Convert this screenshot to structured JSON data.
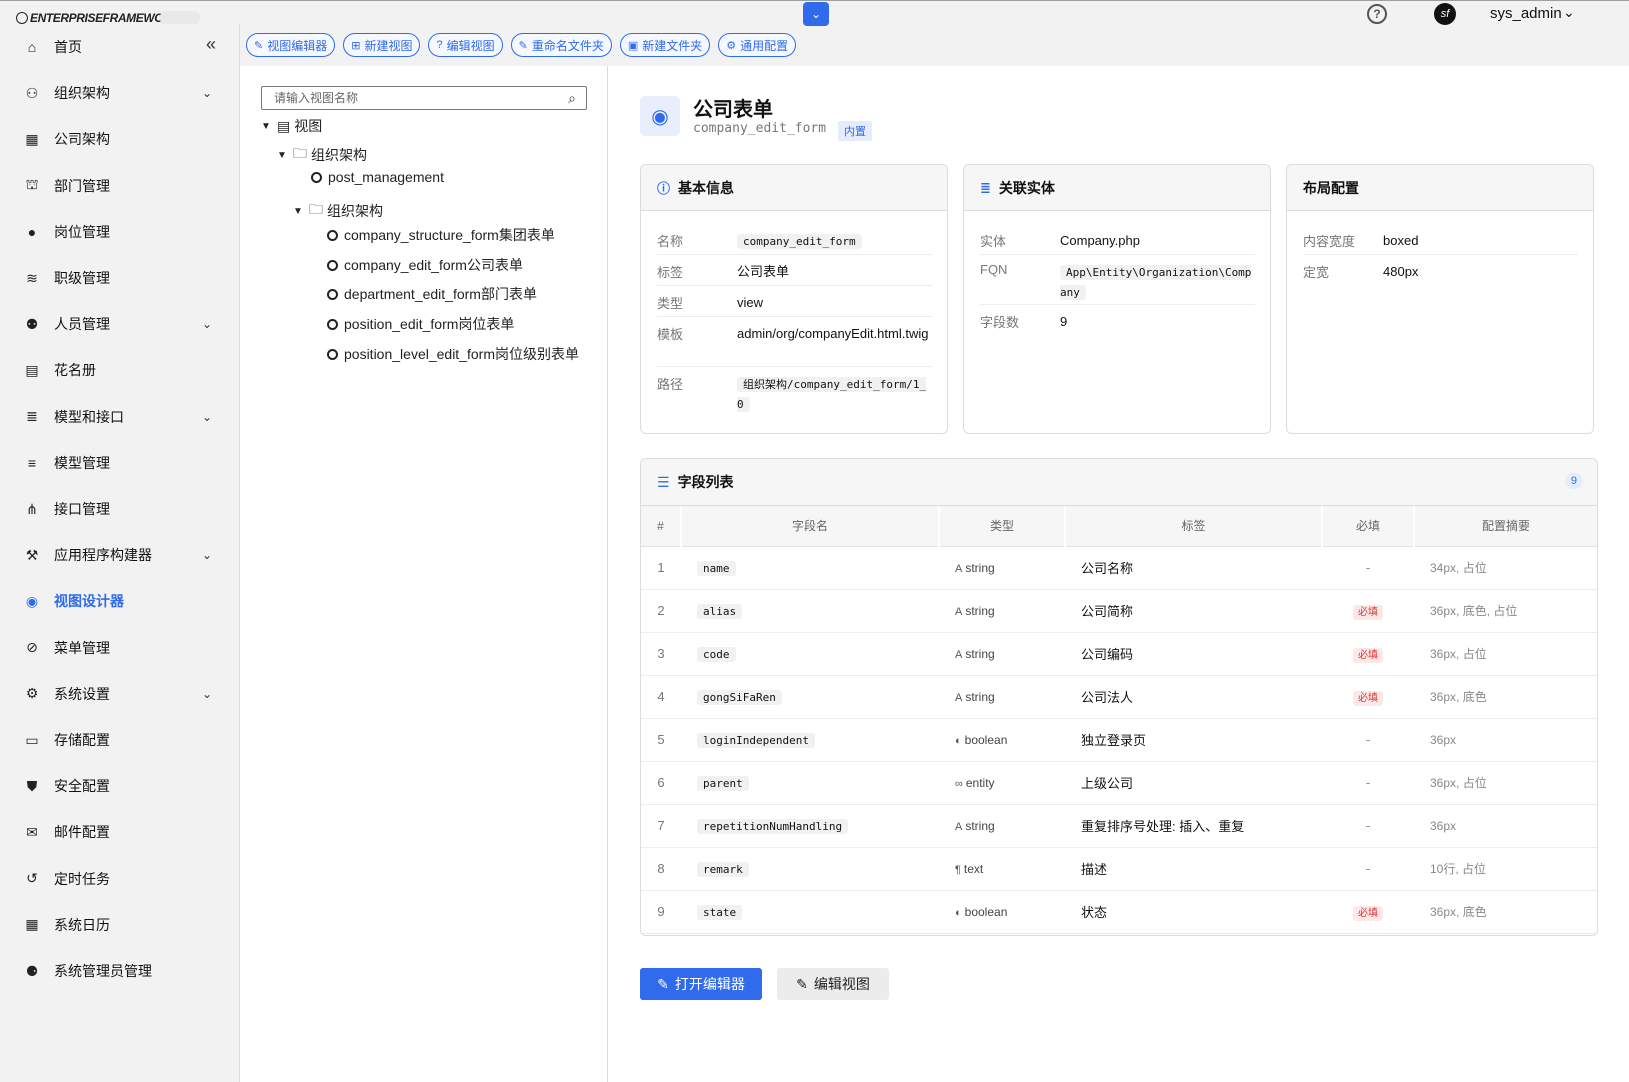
{
  "topbar": {
    "logo_text": "ENTERPRISEFRAMEWORK",
    "user_name": "sys_admin",
    "avatar_text": "sf"
  },
  "toolbar": [
    {
      "icon": "pen-square-icon",
      "glyph": "✎",
      "label": "视图编辑器"
    },
    {
      "icon": "plus-square-icon",
      "glyph": "⊞",
      "label": "新建视图"
    },
    {
      "icon": "question-circle-icon",
      "glyph": "?",
      "label": "编辑视图"
    },
    {
      "icon": "pen-icon",
      "glyph": "✎",
      "label": "重命名文件夹"
    },
    {
      "icon": "folder-plus-icon",
      "glyph": "▣",
      "label": "新建文件夹"
    },
    {
      "icon": "gear-icon",
      "glyph": "⚙",
      "label": "通用配置"
    }
  ],
  "sidebar": {
    "items": [
      {
        "icon": "home-icon",
        "glyph": "⌂",
        "label": "首页",
        "chevron": false
      },
      {
        "icon": "org-chart-icon",
        "glyph": "⚇",
        "label": "组织架构",
        "chevron": true
      },
      {
        "icon": "building-icon",
        "glyph": "▦",
        "label": "公司架构",
        "chevron": false
      },
      {
        "icon": "department-icon",
        "glyph": "⛫",
        "label": "部门管理",
        "chevron": false
      },
      {
        "icon": "user-icon",
        "glyph": "●",
        "label": "岗位管理",
        "chevron": false
      },
      {
        "icon": "layers-icon",
        "glyph": "≋",
        "label": "职级管理",
        "chevron": false
      },
      {
        "icon": "users-icon",
        "glyph": "⚉",
        "label": "人员管理",
        "chevron": true
      },
      {
        "icon": "id-card-icon",
        "glyph": "▤",
        "label": "花名册",
        "chevron": false
      },
      {
        "icon": "database-icon",
        "glyph": "≣",
        "label": "模型和接口",
        "chevron": true
      },
      {
        "icon": "coins-icon",
        "glyph": "≡",
        "label": "模型管理",
        "chevron": false
      },
      {
        "icon": "api-icon",
        "glyph": "⋔",
        "label": "接口管理",
        "chevron": false
      },
      {
        "icon": "builder-icon",
        "glyph": "⚒",
        "label": "应用程序构建器",
        "chevron": true
      },
      {
        "icon": "eye-icon",
        "glyph": "◉",
        "label": "视图设计器",
        "chevron": false,
        "active": true
      },
      {
        "icon": "compass-icon",
        "glyph": "⊘",
        "label": "菜单管理",
        "chevron": false
      },
      {
        "icon": "gears-icon",
        "glyph": "⚙",
        "label": "系统设置",
        "chevron": true
      },
      {
        "icon": "server-icon",
        "glyph": "▭",
        "label": "存储配置",
        "chevron": false
      },
      {
        "icon": "shield-icon",
        "glyph": "⛊",
        "label": "安全配置",
        "chevron": false
      },
      {
        "icon": "envelope-icon",
        "glyph": "✉",
        "label": "邮件配置",
        "chevron": false
      },
      {
        "icon": "history-icon",
        "glyph": "↺",
        "label": "定时任务",
        "chevron": false
      },
      {
        "icon": "calendar-icon",
        "glyph": "▦",
        "label": "系统日历",
        "chevron": false
      },
      {
        "icon": "user-gear-icon",
        "glyph": "⚈",
        "label": "系统管理员管理",
        "chevron": false
      }
    ]
  },
  "tree": {
    "search_placeholder": "请输入视图名称",
    "nodes": [
      {
        "label": "视图",
        "kind": "root"
      },
      {
        "label": "组织架构",
        "kind": "folder"
      },
      {
        "label": "post_management",
        "kind": "leaf"
      },
      {
        "label": "组织架构",
        "kind": "folder"
      },
      {
        "label": "company_structure_form集团表单",
        "kind": "leaf"
      },
      {
        "label": "company_edit_form公司表单",
        "kind": "leaf"
      },
      {
        "label": "department_edit_form部门表单",
        "kind": "leaf"
      },
      {
        "label": "position_edit_form岗位表单",
        "kind": "leaf"
      },
      {
        "label": "position_level_edit_form岗位级别表单",
        "kind": "leaf"
      }
    ]
  },
  "header": {
    "title": "公司表单",
    "code": "company_edit_form",
    "badge": "内置"
  },
  "basic_info": {
    "title": "基本信息",
    "rows": [
      {
        "key": "名称",
        "value": "company_edit_form",
        "code": true
      },
      {
        "key": "标签",
        "value": "公司表单",
        "code": false
      },
      {
        "key": "类型",
        "value": "view",
        "code": false
      },
      {
        "key": "模板",
        "value": "admin/org/companyEdit.html.twig",
        "code": false
      },
      {
        "key": "路径",
        "value": "组织架构/company_edit_form/1_0",
        "code": true
      }
    ]
  },
  "entity_info": {
    "title": "关联实体",
    "rows": [
      {
        "key": "实体",
        "value": "Company.php",
        "code": false
      },
      {
        "key": "FQN",
        "value": "App\\Entity\\Organization\\Company",
        "code": true
      },
      {
        "key": "字段数",
        "value": "9",
        "code": false
      }
    ]
  },
  "layout_info": {
    "title": "布局配置",
    "rows": [
      {
        "key": "内容宽度",
        "value": "boxed",
        "code": false
      },
      {
        "key": "定宽",
        "value": "480px",
        "code": false
      }
    ]
  },
  "fields": {
    "title": "字段列表",
    "count": "9",
    "columns": [
      "#",
      "字段名",
      "类型",
      "标签",
      "必填",
      "配置摘要"
    ],
    "rows": [
      {
        "idx": "1",
        "name": "name",
        "type": "string",
        "type_icon": "A",
        "label": "公司名称",
        "required": "-",
        "summary": "34px, 占位"
      },
      {
        "idx": "2",
        "name": "alias",
        "type": "string",
        "type_icon": "A",
        "label": "公司简称",
        "required": "必填",
        "summary": "36px, 底色, 占位"
      },
      {
        "idx": "3",
        "name": "code",
        "type": "string",
        "type_icon": "A",
        "label": "公司编码",
        "required": "必填",
        "summary": "36px, 占位"
      },
      {
        "idx": "4",
        "name": "gongSiFaRen",
        "type": "string",
        "type_icon": "A",
        "label": "公司法人",
        "required": "必填",
        "summary": "36px, 底色"
      },
      {
        "idx": "5",
        "name": "loginIndependent",
        "type": "boolean",
        "type_icon": "◐",
        "label": "独立登录页",
        "required": "-",
        "summary": "36px"
      },
      {
        "idx": "6",
        "name": "parent",
        "type": "entity",
        "type_icon": "∞",
        "label": "上级公司",
        "required": "-",
        "summary": "36px, 占位"
      },
      {
        "idx": "7",
        "name": "repetitionNumHandling",
        "type": "string",
        "type_icon": "A",
        "label": "重复排序号处理: 插入、重复",
        "required": "-",
        "summary": "36px"
      },
      {
        "idx": "8",
        "name": "remark",
        "type": "text",
        "type_icon": "¶",
        "label": "描述",
        "required": "-",
        "summary": "10行, 占位"
      },
      {
        "idx": "9",
        "name": "state",
        "type": "boolean",
        "type_icon": "◐",
        "label": "状态",
        "required": "必填",
        "summary": "36px, 底色"
      }
    ]
  },
  "actions": {
    "open_editor": "打开编辑器",
    "edit_view": "编辑视图"
  },
  "colors": {
    "accent": "#2f6bea",
    "danger": "#d33333"
  }
}
